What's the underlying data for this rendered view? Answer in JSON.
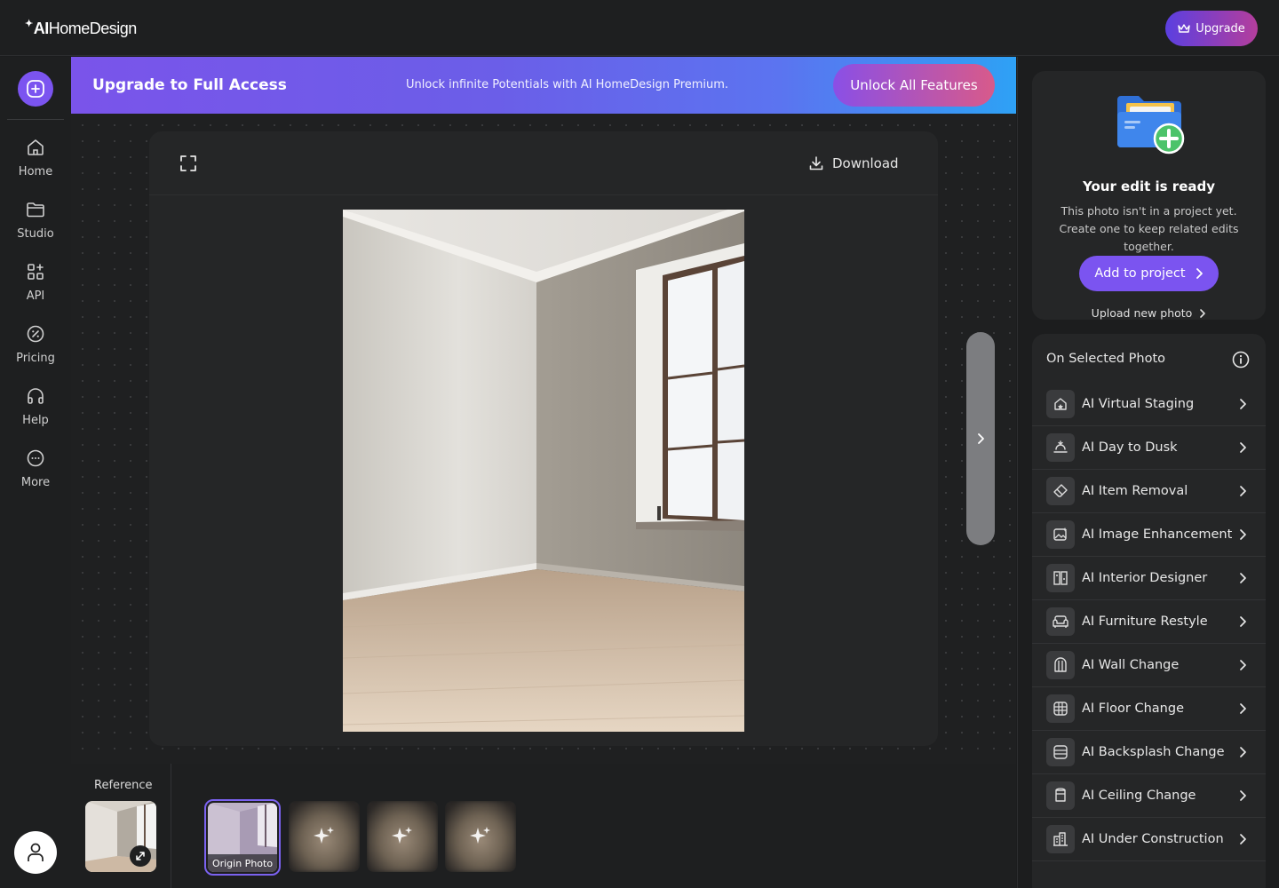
{
  "app": {
    "logo_text_bold": "AI",
    "logo_text": "HomeDesign",
    "upgrade_label": "Upgrade"
  },
  "nav": {
    "items": [
      {
        "label": "Home",
        "icon": "home-icon"
      },
      {
        "label": "Studio",
        "icon": "folder-icon"
      },
      {
        "label": "API",
        "icon": "grid-plus-icon"
      },
      {
        "label": "Pricing",
        "icon": "percent-icon"
      },
      {
        "label": "Help",
        "icon": "headphones-icon"
      },
      {
        "label": "More",
        "icon": "more-icon"
      }
    ]
  },
  "banner": {
    "title": "Upgrade to Full Access",
    "subtitle": "Unlock infinite Potentials with AI HomeDesign Premium.",
    "button": "Unlock All Features"
  },
  "viewer": {
    "download_label": "Download"
  },
  "strip": {
    "reference_label": "Reference",
    "origin_label": "Origin Photo",
    "generating_count": 3
  },
  "ready": {
    "title": "Your edit is ready",
    "description": "This photo isn't in a project yet. Create one to keep related edits together.",
    "add_button": "Add to project",
    "upload_link": "Upload new photo"
  },
  "tools": {
    "heading": "On Selected Photo",
    "items": [
      {
        "label": "AI Virtual Staging",
        "icon": "staging-icon"
      },
      {
        "label": "AI Day to Dusk",
        "icon": "sunset-icon"
      },
      {
        "label": "AI Item Removal",
        "icon": "eraser-icon"
      },
      {
        "label": "AI Image Enhancement",
        "icon": "enhance-icon"
      },
      {
        "label": "AI Interior Designer",
        "icon": "interior-icon"
      },
      {
        "label": "AI Furniture Restyle",
        "icon": "sofa-icon"
      },
      {
        "label": "AI Wall Change",
        "icon": "wall-icon"
      },
      {
        "label": "AI Floor Change",
        "icon": "floor-icon"
      },
      {
        "label": "AI Backsplash Change",
        "icon": "backsplash-icon"
      },
      {
        "label": "AI Ceiling Change",
        "icon": "ceiling-icon"
      },
      {
        "label": "AI Under Construction",
        "icon": "construction-icon"
      }
    ]
  },
  "colors": {
    "accent": "#7b54f0",
    "panel": "#252627",
    "background": "#1c1d1e"
  }
}
